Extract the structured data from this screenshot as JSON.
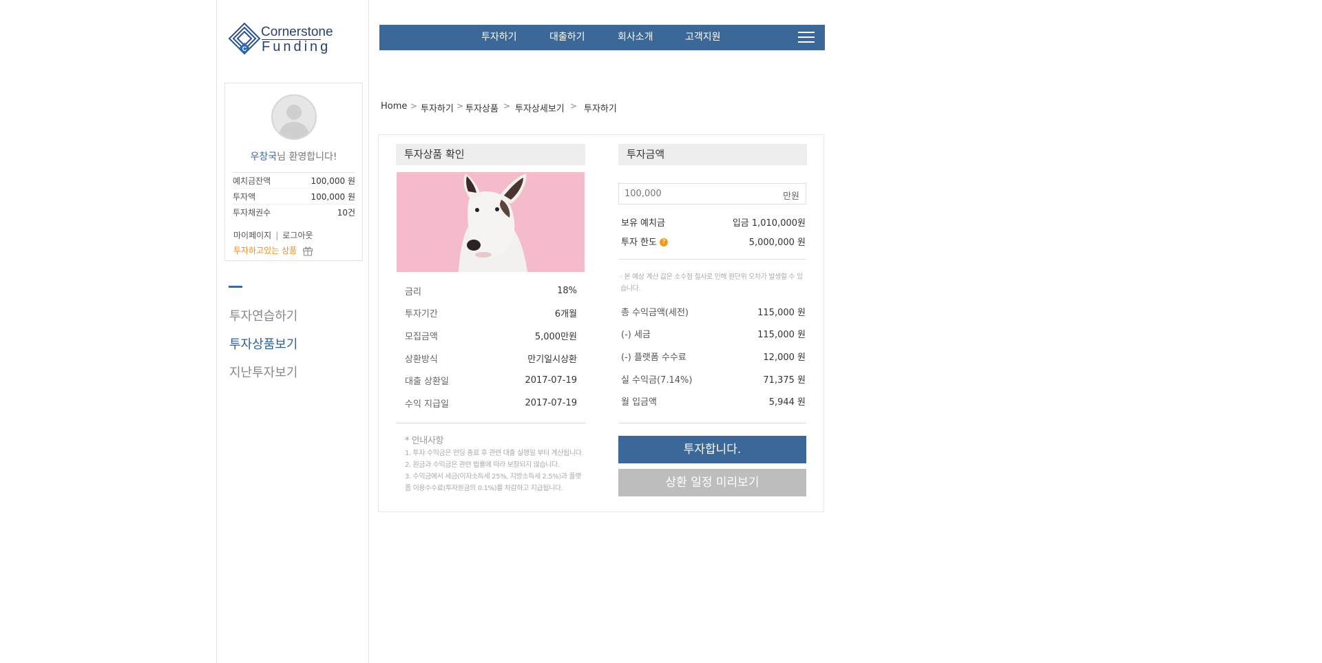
{
  "brand": {
    "name_line1": "Cornerstone",
    "name_line2": "Funding"
  },
  "profile": {
    "user_name": "우창국",
    "welcome_suffix": "님 환영합니다!",
    "rows": [
      {
        "label": "예치금잔액",
        "value": "100,000 원"
      },
      {
        "label": "투자액",
        "value": "100,000 원"
      },
      {
        "label": "투자채권수",
        "value": "10건"
      }
    ],
    "mypage_link": "마이페이지",
    "separator": "|",
    "logout_link": "로그아웃",
    "invested_products_link": "투자하고있는 상품"
  },
  "sidebar": {
    "items": [
      {
        "label": "투자연습하기",
        "active": false
      },
      {
        "label": "투자상품보기",
        "active": true
      },
      {
        "label": "지난투자보기",
        "active": false
      }
    ]
  },
  "nav": {
    "items": [
      "투자하기",
      "대출하기",
      "회사소개",
      "고객지원"
    ]
  },
  "breadcrumb": {
    "items": [
      "Home",
      "투자하기",
      "투자상품",
      "투자상세보기",
      "투자하기"
    ],
    "separator": ">"
  },
  "product": {
    "section_title": "투자상품 확인",
    "rows": [
      {
        "label": "금리",
        "value": "18%"
      },
      {
        "label": "투자기간",
        "value": "6개월"
      },
      {
        "label": "모집금액",
        "value": "5,000만원"
      },
      {
        "label": "상환방식",
        "value": "만기일시상환"
      },
      {
        "label": "대출 상환일",
        "value": "2017-07-19"
      },
      {
        "label": "수익 지급일",
        "value": "2017-07-19"
      }
    ],
    "notice_title": "* 안내사항",
    "notice_lines": [
      "1. 투자 수익금은 펀딩 종료 후 관련 대출 실행일 부터 계산됩니다.",
      "2. 원금과 수익금은 관련 법률에 따라 보장되지 않습니다.",
      "3. 수익금에서 세금(이자소득세 25%, 지방소득세 2.5%)과 플랫폼 이용수수료(투자원금의 0.1%)를 차감하고 지급됩니다."
    ]
  },
  "investment": {
    "section_title": "투자금액",
    "amount_value": "100,000",
    "amount_unit": "만원",
    "balance_rows": [
      {
        "label": "보유 예치금",
        "value": "입금 1,010,000원",
        "help": false
      },
      {
        "label": "투자 한도",
        "value": "5,000,000 원",
        "help": true
      }
    ],
    "help_glyph": "?",
    "disclaimer": "· 본 예상 계산 값은 소수점 절사로 인해 원단위 오차가 발생할 수 있습니다.",
    "calc_rows": [
      {
        "label": "총 수익금액(세전)",
        "value": "115,000 원"
      },
      {
        "label": "(-) 세금",
        "value": "115,000 원"
      },
      {
        "label": "(-) 플랫폼 수수료",
        "value": "12,000 원"
      },
      {
        "label": "실 수익금(7.14%)",
        "value": "71,375 원"
      },
      {
        "label": "월 입금액",
        "value": "5,944 원"
      }
    ],
    "invest_button": "투자합니다.",
    "schedule_button": "상환 일정 미리보기"
  },
  "colors": {
    "primary": "#3c6799",
    "accent_orange": "#f08a1c",
    "button_disabled": "#bdbdbd"
  },
  "icons": [
    "cornerstone-logo-icon",
    "user-avatar-icon",
    "gift-icon",
    "hamburger-menu-icon",
    "help-icon",
    "chevron-right-icon"
  ]
}
